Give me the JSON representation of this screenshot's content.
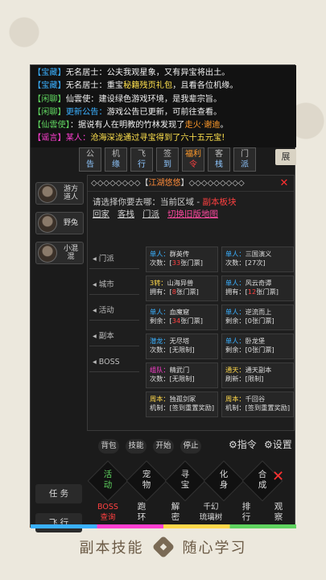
{
  "chat": [
    {
      "tag": "【宝藏】",
      "name": "无名居士：",
      "text": "公夫我观星象，又有异宝将出土。",
      "tag_class": "tag-treasure"
    },
    {
      "tag": "【宝藏】",
      "name": "无名居士：",
      "text_pre": "重宝",
      "highlight": "秘籍残页礼包",
      "text": "，且看各位机缘。",
      "tag_class": "tag-treasure"
    },
    {
      "tag": "【闲聊】",
      "name": "仙雲使：",
      "text": "建设绿色游戏环境，是我辈宗旨。",
      "tag_class": "tag-chat"
    },
    {
      "tag": "【闲聊】",
      "name": "更新公告：",
      "text": "游戏公告已更新，可前往查看。",
      "tag_class": "tag-chat"
    },
    {
      "tag": "【仙雲使】",
      "name": "",
      "text_pre": "：据说有人在明教的竹林发现了",
      "highlight": "走火·谢迪",
      "text": "。",
      "tag_class": "tag-chat"
    },
    {
      "tag": "【谣言】",
      "name": "某人：",
      "text": "沧海深泷通过寻宝得到了六十五元宝!",
      "tag_class": "tag-rumor"
    }
  ],
  "topnav": [
    {
      "l1": "公",
      "l2": "告"
    },
    {
      "l1": "机",
      "l2": "缘"
    },
    {
      "l1": "飞",
      "l2": "行"
    },
    {
      "l1": "签",
      "l2": "到"
    },
    {
      "l1": "福利",
      "l2": "令",
      "hl": true
    },
    {
      "l1": "客",
      "l2": "栈"
    },
    {
      "l1": "门",
      "l2": "派"
    }
  ],
  "expand_label": "展",
  "npcs": [
    {
      "name": "游方道人"
    },
    {
      "name": "野兔"
    },
    {
      "name": "小混混"
    }
  ],
  "panel": {
    "title_prefix": "◇◇◇◇◇◇◇◇【",
    "title": "江湖悠悠",
    "title_suffix": "】◇◇◇◇◇◇◇◇◇",
    "prompt": "请选择你要去哪：当前区域 - ",
    "current_area": "副本板块",
    "links": [
      "回家",
      "客栈",
      "门派"
    ],
    "link_hl": "切换旧版地图",
    "side_tabs": [
      "门派",
      "城市",
      "活动",
      "副本",
      "BOSS"
    ],
    "cards": [
      [
        {
          "lb": "单人：",
          "name": "群英传",
          "k": "次数：",
          "pre": "[",
          "red": "33",
          "post": "张门票]",
          "cls": "c"
        },
        {
          "lb": "单人：",
          "name": "三国演义",
          "k": "次数：",
          "pre": "[27次]",
          "red": "",
          "post": "",
          "cls": "c"
        }
      ],
      [
        {
          "lb": "3转：",
          "name": "山海异兽",
          "k": "拥有：",
          "pre": "[",
          "red": "8",
          "post": "张门票]",
          "cls": "y"
        },
        {
          "lb": "单人：",
          "name": "风云奇谭",
          "k": "拥有：",
          "pre": "[",
          "red": "12",
          "post": "张门票]",
          "cls": "c"
        }
      ],
      [
        {
          "lb": "单人：",
          "name": "血魔窟",
          "k": "剩余：",
          "pre": "[",
          "red": "34",
          "post": "张门票]",
          "cls": "c"
        },
        {
          "lb": "单人：",
          "name": "逆流而上",
          "k": "剩余：",
          "pre": "[0张门票]",
          "red": "",
          "post": "",
          "cls": "c"
        }
      ],
      [
        {
          "lb": "潜龙：",
          "name": "无尽塔",
          "k": "次数：",
          "pre": "[无限制]",
          "red": "",
          "post": "",
          "cls": "c"
        },
        {
          "lb": "单人：",
          "name": "卧龙堡",
          "k": "剩余：",
          "pre": "[0张门票]",
          "red": "",
          "post": "",
          "cls": "c"
        }
      ],
      [
        {
          "lb": "组队：",
          "name": "精武门",
          "k": "次数：",
          "pre": "[无限制]",
          "red": "",
          "post": "",
          "cls": ""
        },
        {
          "lb": "通天：",
          "name": "通天副本",
          "k": "刷新：",
          "pre": "[限制]",
          "red": "",
          "post": "",
          "cls": "o"
        }
      ],
      [
        {
          "lb": "周本：",
          "name": "独孤剑冢",
          "k": "机制：",
          "pre": "[签到重置奖励]",
          "red": "",
          "post": "",
          "cls": "o"
        },
        {
          "lb": "周本：",
          "name": "千回谷",
          "k": "机制：",
          "pre": "[签到重置奖励]",
          "red": "",
          "post": "",
          "cls": "o"
        }
      ]
    ]
  },
  "actions": [
    "背包",
    "技能",
    "开始",
    "停止"
  ],
  "cmd_label": "指令",
  "settings_label": "设置",
  "left_bottom": [
    "任 务",
    "飞 行"
  ],
  "skills_row1": [
    {
      "label": "活\n动",
      "cls": "g"
    },
    {
      "label": "宠\n物",
      "cls": ""
    },
    {
      "label": "寻\n宝",
      "cls": ""
    },
    {
      "label": "化\n身",
      "cls": ""
    },
    {
      "label": "合\n成",
      "cls": ""
    }
  ],
  "skills_row2": [
    {
      "label": "BOSS\n查询",
      "cls": "r"
    },
    {
      "label": "跑\n环",
      "cls": ""
    },
    {
      "label": "解\n密",
      "cls": ""
    },
    {
      "label": "千幻\n琉璃树",
      "cls": ""
    },
    {
      "label": "排\n行",
      "cls": ""
    },
    {
      "label": "观\n察",
      "cls": ""
    }
  ],
  "caption": {
    "left": "副本技能",
    "right": "随心学习"
  }
}
